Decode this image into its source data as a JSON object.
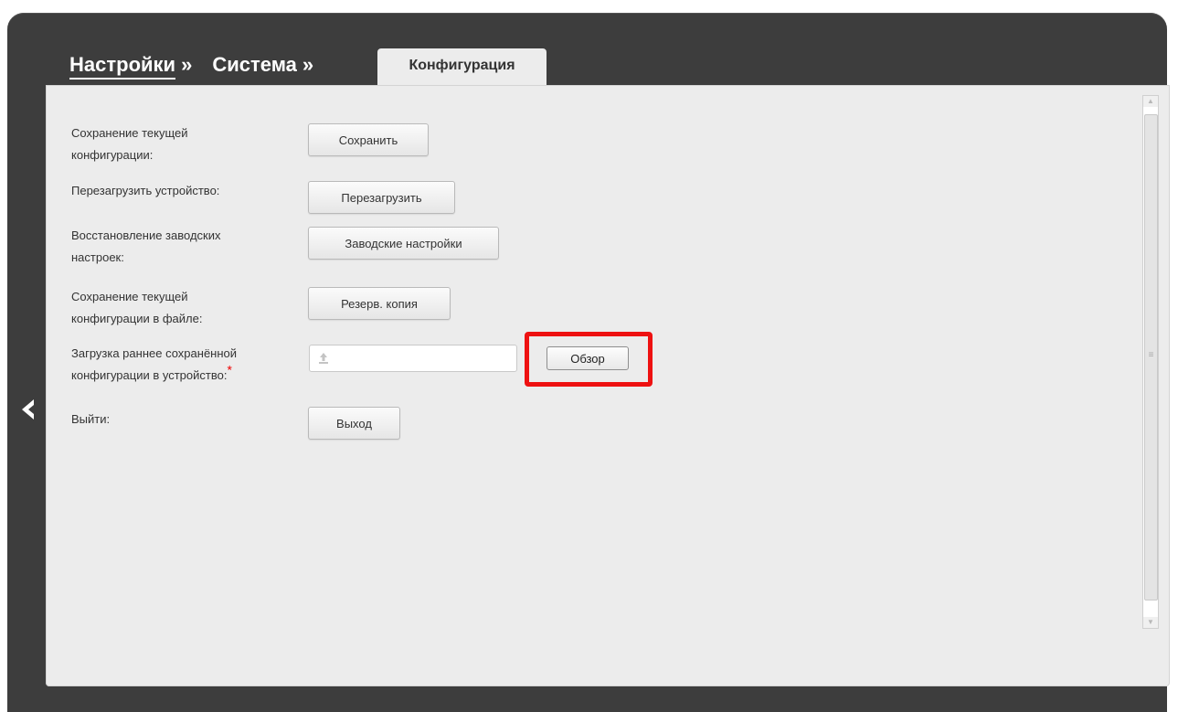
{
  "breadcrumb": {
    "items": [
      {
        "label": "Настройки",
        "sep": "»"
      },
      {
        "label": "Система",
        "sep": "»"
      }
    ],
    "active_tab": "Конфигурация"
  },
  "rows": [
    {
      "label_line1": "Сохранение текущей",
      "label_line2": "конфигурации:",
      "button": "Сохранить"
    },
    {
      "label_line1": "Перезагрузить устройство:",
      "button": "Перезагрузить"
    },
    {
      "label_line1": "Восстановление заводских",
      "label_line2": "настроек:",
      "button": "Заводские настройки"
    },
    {
      "label_line1": "Сохранение текущей",
      "label_line2": "конфигурации в файле:",
      "button": "Резерв. копия"
    },
    {
      "label_line1": "Загрузка раннее сохранённой",
      "label_line2": "конфигурации в устройство:",
      "required_mark": "*",
      "browse_button": "Обзор",
      "file_value": ""
    },
    {
      "label_line1": "Выйти:",
      "button": "Выход"
    }
  ],
  "icons": {
    "back": "chevron-left-icon",
    "upload": "upload-icon"
  },
  "colors": {
    "frame": "#3d3d3d",
    "panel": "#ececec",
    "highlight": "#ee1111"
  }
}
